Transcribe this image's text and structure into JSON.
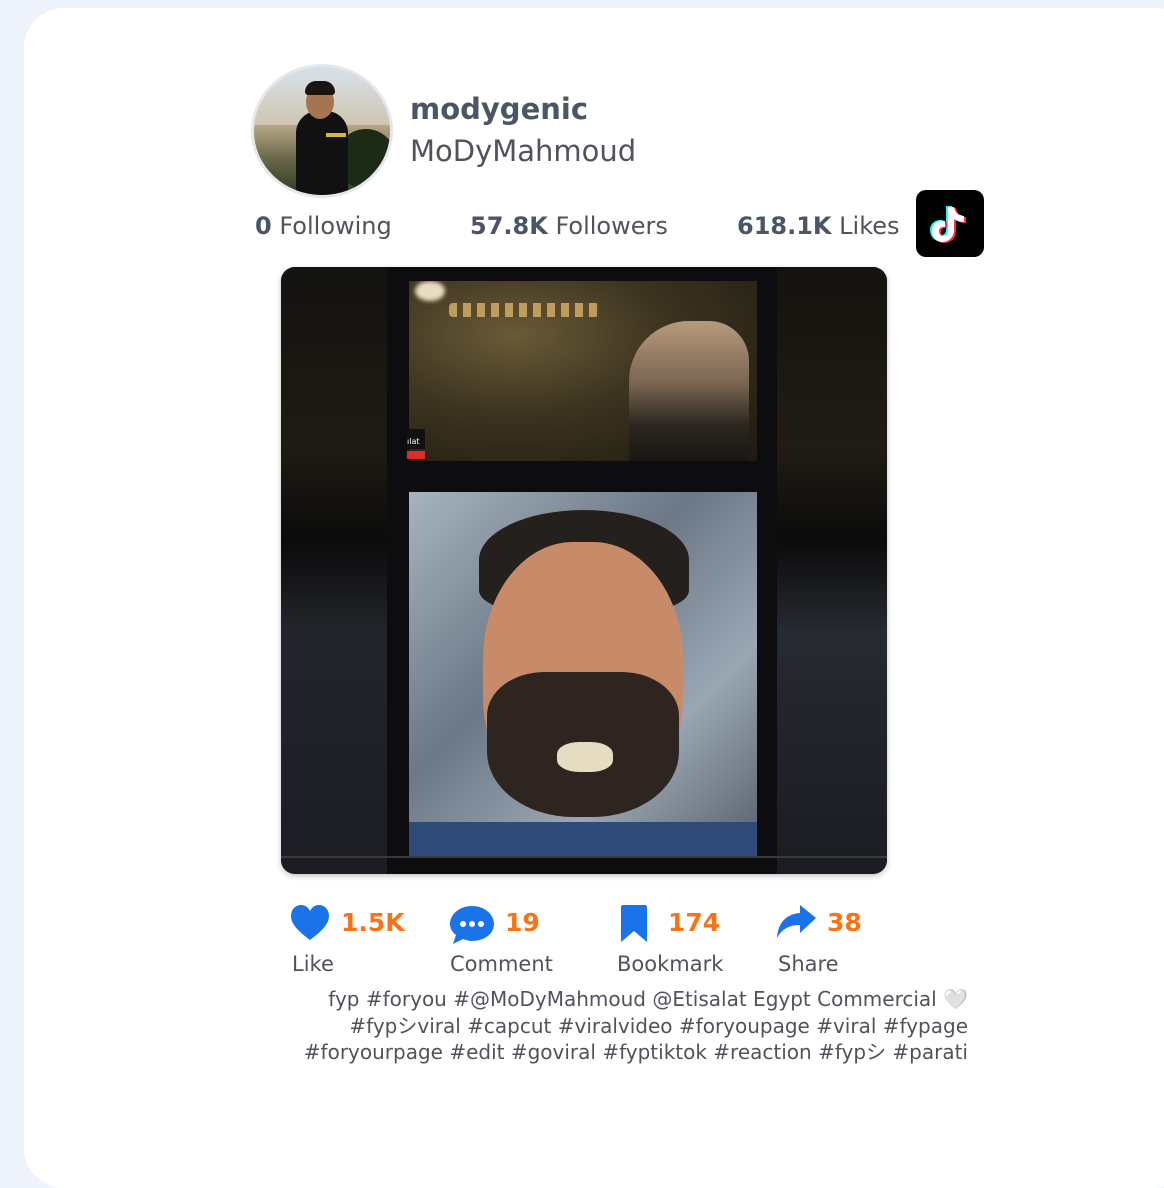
{
  "profile": {
    "username": "modygenic",
    "display_name": "MoDyMahmoud"
  },
  "stats": {
    "following_count": "0",
    "following_label": "Following",
    "followers_count": "57.8K",
    "followers_label": "Followers",
    "likes_count": "618.1K",
    "likes_label": "Likes"
  },
  "video": {
    "overlay_text": "ılat"
  },
  "actions": {
    "like": {
      "count": "1.5K",
      "label": "Like",
      "icon": "heart-icon"
    },
    "comment": {
      "count": "19",
      "label": "Comment",
      "icon": "comment-icon"
    },
    "bookmark": {
      "count": "174",
      "label": "Bookmark",
      "icon": "bookmark-icon"
    },
    "share": {
      "count": "38",
      "label": "Share",
      "icon": "share-icon"
    }
  },
  "caption": {
    "line1": "fyp #foryou #@MoDyMahmoud @Etisalat Egypt Commercial 🤍",
    "line2": "#fypシviral #capcut #viralvideo #foryoupage #viral #fypage",
    "line3": "#foryourpage #edit #goviral #fyptiktok #reaction #fypシ #parati"
  },
  "colors": {
    "accent_count": "#f97316",
    "icon_blue": "#1a73e8",
    "background": "#eef3fb"
  }
}
